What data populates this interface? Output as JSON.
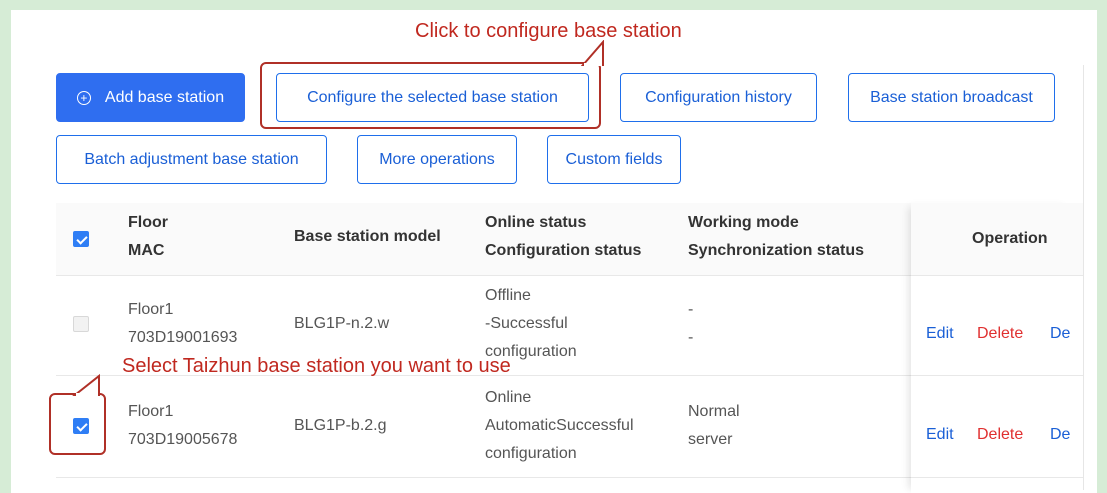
{
  "toolbar": {
    "add_label": "Add base station",
    "configure_label": "Configure the selected base station",
    "history_label": "Configuration history",
    "broadcast_label": "Base station broadcast",
    "batch_label": "Batch adjustment base station",
    "more_label": "More operations",
    "custom_label": "Custom fields"
  },
  "annotations": {
    "top": "Click to  configure base station",
    "middle": "Select Taizhun base station you want to use",
    "color": "#c0281f"
  },
  "table": {
    "headers": {
      "floor": "Floor",
      "mac": "MAC",
      "model": "Base station model",
      "online": "Online status",
      "config": "Configuration status",
      "working": "Working mode",
      "sync": "Synchronization status",
      "operation": "Operation"
    },
    "rows": [
      {
        "checked": false,
        "floor": "Floor1",
        "mac": "703D19001693",
        "model": "BLG1P-n.2.w",
        "status_line1": "Offline",
        "status_line2": "-Successful",
        "status_line3": "configuration",
        "mode": "-",
        "sync": "-"
      },
      {
        "checked": true,
        "floor": "Floor1",
        "mac": "703D19005678",
        "model": "BLG1P-b.2.g",
        "status_line1": "Online",
        "status_line2": "AutomaticSuccessful",
        "status_line3": "configuration",
        "mode": "Normal",
        "sync": "server"
      }
    ],
    "ops": {
      "edit": "Edit",
      "delete": "Delete",
      "more": "De"
    }
  },
  "colors": {
    "primary": "#2f6ef0",
    "link": "#1a5fd6",
    "danger": "#e03030",
    "background": "#d6ecd6"
  }
}
